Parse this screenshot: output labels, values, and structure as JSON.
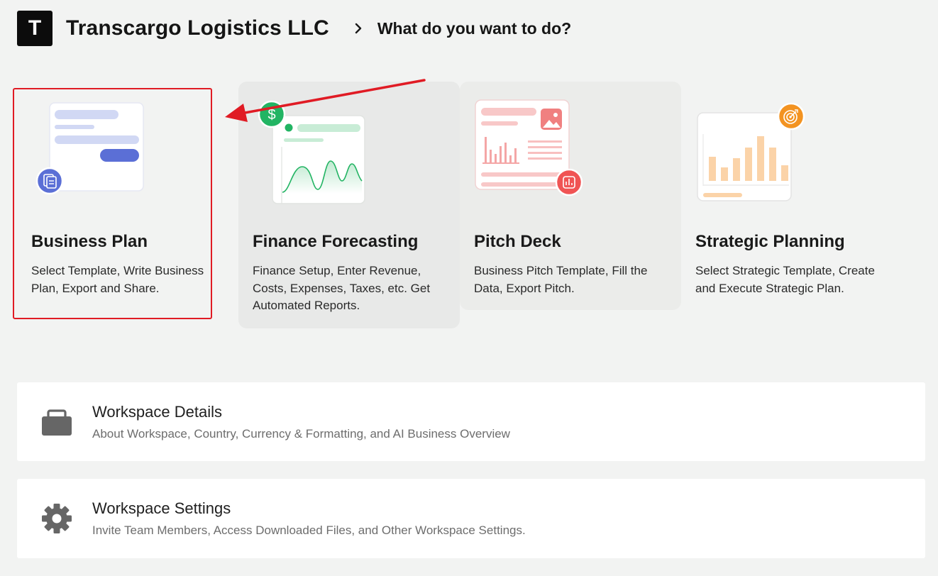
{
  "header": {
    "logo_letter": "T",
    "company_name": "Transcargo Logistics LLC",
    "page_title": "What do you want to do?"
  },
  "cards": [
    {
      "title": "Business Plan",
      "description": "Select Template, Write Business Plan, Export and Share.",
      "accent": "#5b6fd6",
      "icon": "document-icon"
    },
    {
      "title": "Finance Forecasting",
      "description": "Finance Setup, Enter Revenue, Costs, Expenses, Taxes, etc. Get Automated Reports.",
      "accent": "#22b463",
      "badge_symbol": "$",
      "icon": "dollar-icon"
    },
    {
      "title": "Pitch Deck",
      "description": "Business Pitch Template, Fill the Data, Export Pitch.",
      "accent": "#f05454",
      "icon": "bar-chart-icon"
    },
    {
      "title": "Strategic Planning",
      "description": "Select Strategic Template, Create and Execute Strategic Plan.",
      "accent": "#f39321",
      "icon": "target-icon"
    }
  ],
  "workspace": [
    {
      "title": "Workspace Details",
      "description": "About Workspace, Country, Currency & Formatting, and AI Business Overview",
      "icon": "briefcase-icon"
    },
    {
      "title": "Workspace Settings",
      "description": "Invite Team Members, Access Downloaded Files, and Other Workspace Settings.",
      "icon": "gear-icon"
    }
  ],
  "annotation": {
    "highlight_color": "#e01b24"
  }
}
